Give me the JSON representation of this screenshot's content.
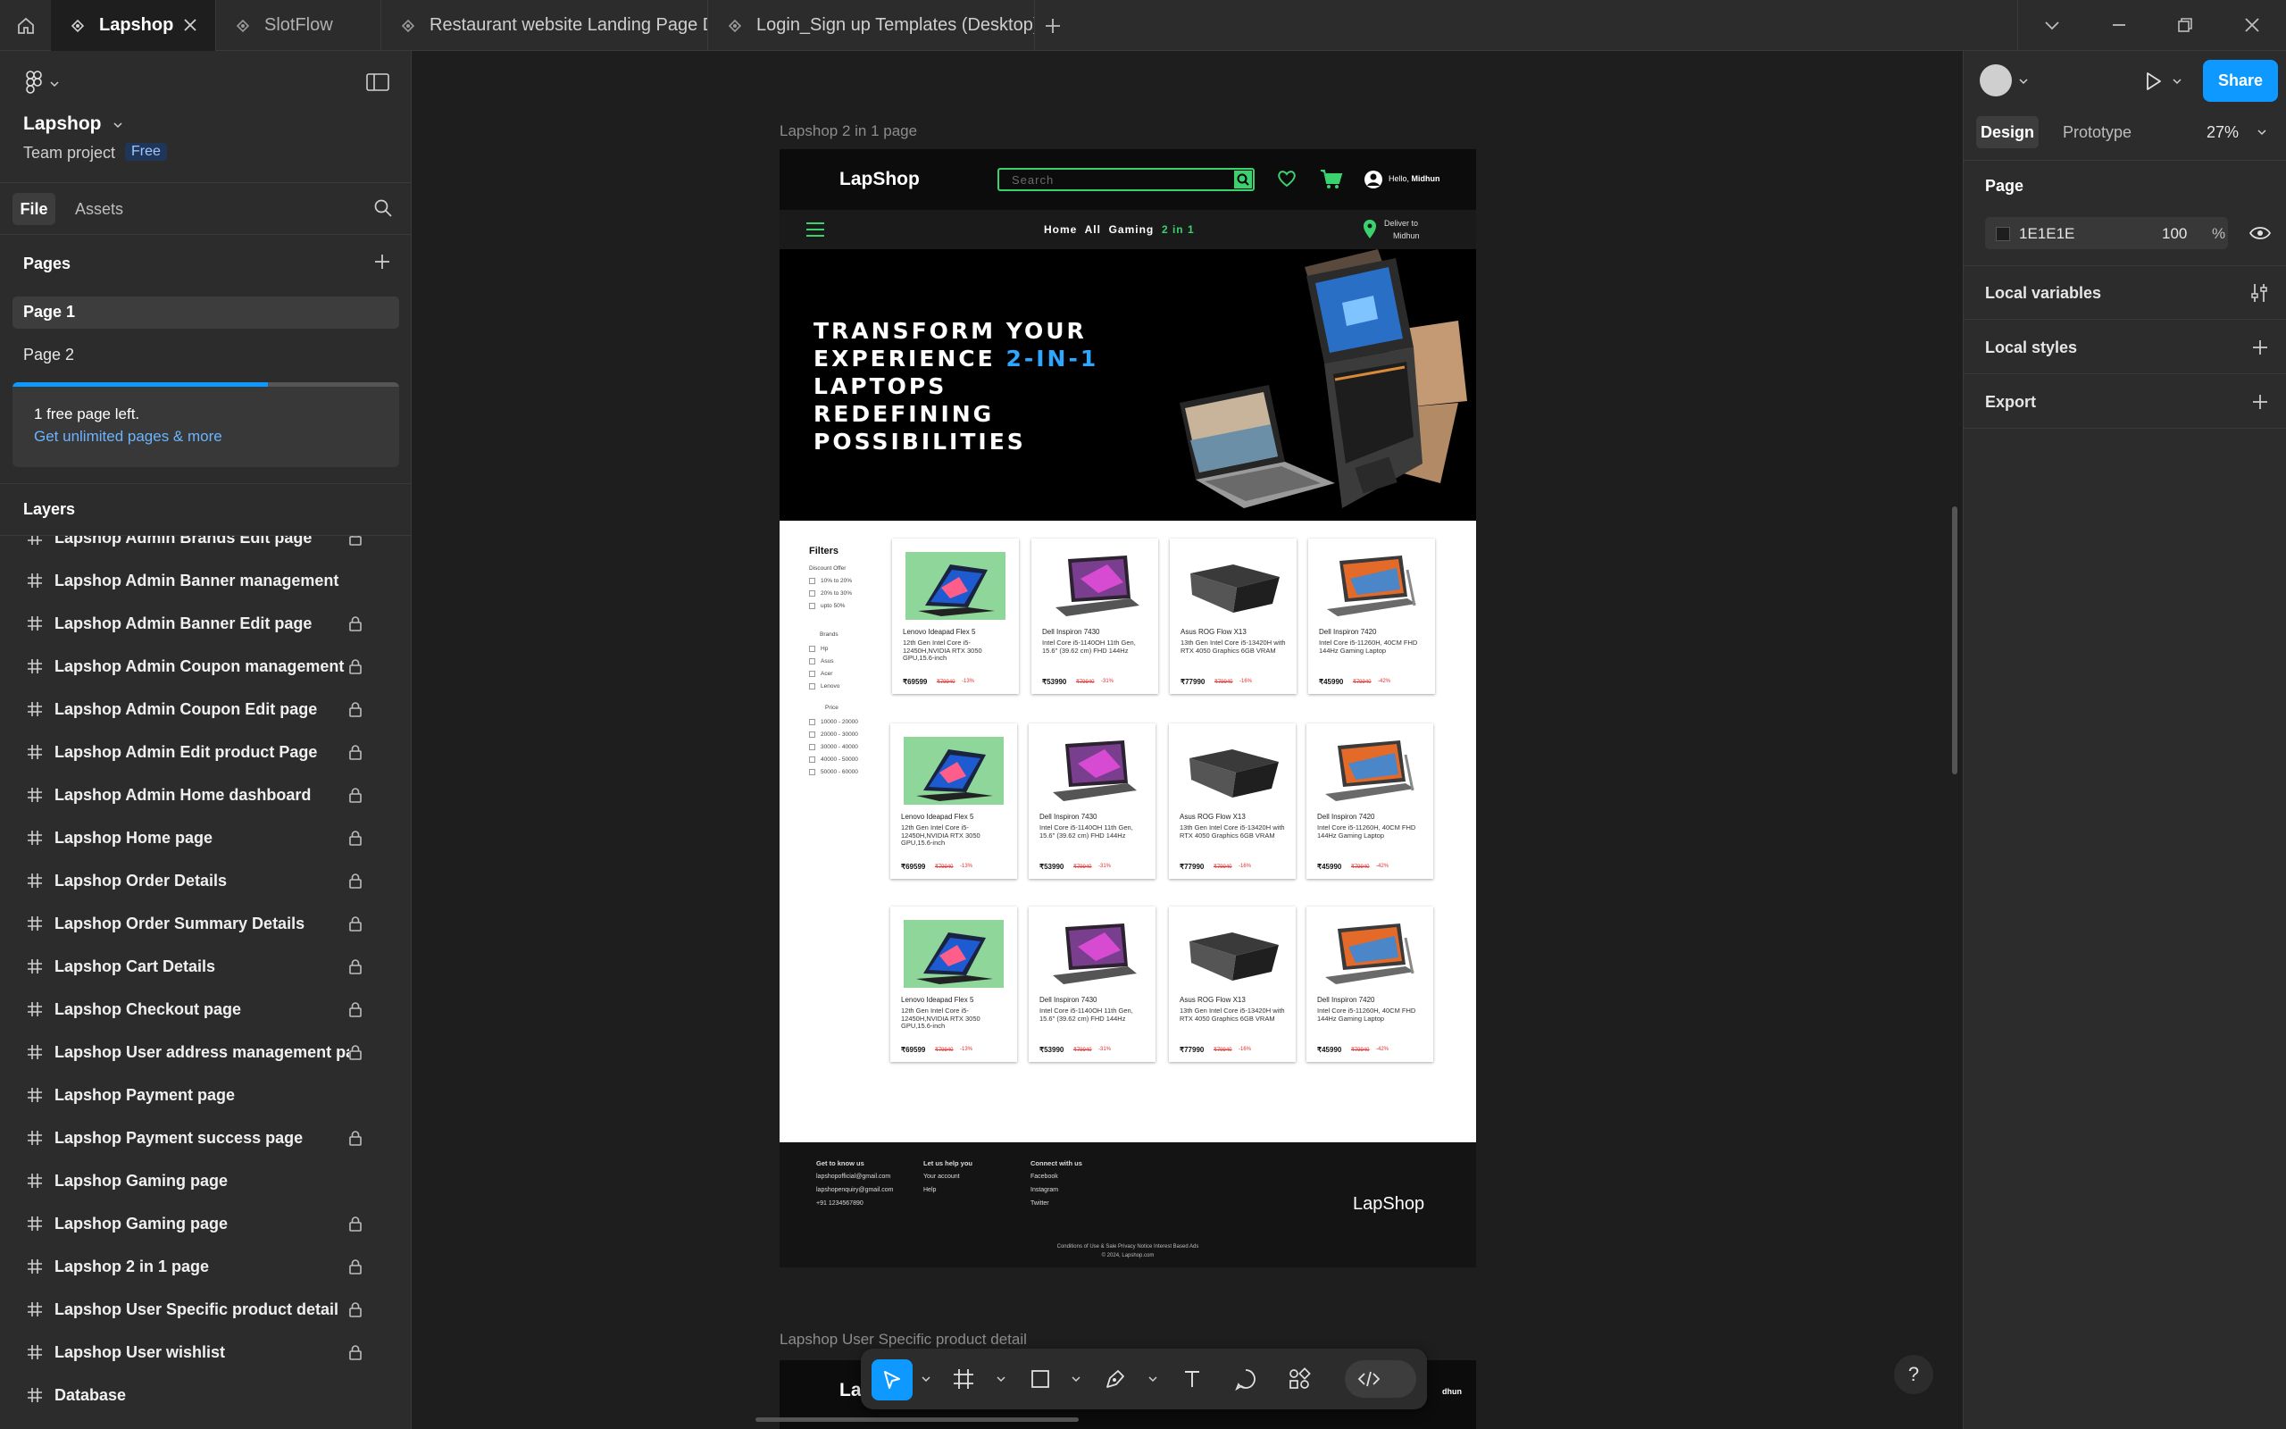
{
  "tabs": [
    {
      "label": "Lapshop",
      "active": true
    },
    {
      "label": "SlotFlow",
      "active": false
    },
    {
      "label": "Restaurant website Landing Page De",
      "active": false
    },
    {
      "label": "Login_Sign up Templates (Desktop) (",
      "active": false
    }
  ],
  "project": {
    "name": "Lapshop",
    "team": "Team project",
    "plan_badge": "Free"
  },
  "panel_tabs": {
    "file": "File",
    "assets": "Assets"
  },
  "pages": {
    "heading": "Pages",
    "items": [
      "Page 1",
      "Page 2"
    ],
    "selected": "Page 1",
    "limit_text": "1 free page left.",
    "upgrade_link": "Get unlimited pages & more",
    "usage_fraction": 0.66
  },
  "layers": {
    "heading": "Layers",
    "items": [
      {
        "name": "Lapshop Admin Brands Edit page",
        "locked": true
      },
      {
        "name": "Lapshop Admin Banner management",
        "locked": false
      },
      {
        "name": "Lapshop Admin Banner Edit page",
        "locked": true
      },
      {
        "name": "Lapshop Admin Coupon management",
        "locked": true
      },
      {
        "name": "Lapshop Admin Coupon Edit page",
        "locked": true
      },
      {
        "name": "Lapshop Admin Edit  product Page",
        "locked": true
      },
      {
        "name": "Lapshop Admin Home dashboard",
        "locked": true
      },
      {
        "name": "Lapshop Home page",
        "locked": true
      },
      {
        "name": "Lapshop Order Details",
        "locked": true
      },
      {
        "name": "Lapshop Order Summary Details",
        "locked": true
      },
      {
        "name": "Lapshop Cart Details",
        "locked": true
      },
      {
        "name": "Lapshop Checkout page",
        "locked": true
      },
      {
        "name": "Lapshop User address management pag",
        "locked": true
      },
      {
        "name": "Lapshop Payment page",
        "locked": false
      },
      {
        "name": "Lapshop Payment success page",
        "locked": true
      },
      {
        "name": "Lapshop Gaming page",
        "locked": false
      },
      {
        "name": "Lapshop Gaming page",
        "locked": true
      },
      {
        "name": "Lapshop 2 in 1 page",
        "locked": true
      },
      {
        "name": "Lapshop User Specific product detail",
        "locked": true
      },
      {
        "name": "Lapshop User wishlist",
        "locked": true
      },
      {
        "name": "Database",
        "locked": false
      }
    ]
  },
  "canvas": {
    "frame_label": "Lapshop 2 in 1 page",
    "frame2_label": "Lapshop User Specific product detail"
  },
  "site": {
    "logo": "LapShop",
    "search_placeholder": "Search",
    "greeting": "Hello,",
    "user": "Midhun",
    "nav": [
      "Home",
      "All",
      "Gaming",
      "2 in 1"
    ],
    "deliver_line1": "Deliver to",
    "deliver_line2": "Midhun",
    "hero_lines": [
      "TRANSFORM YOUR",
      "EXPERIENCE",
      "2-IN-1",
      "LAPTOPS",
      "REDEFINING",
      "POSSIBILITIES"
    ],
    "filters": {
      "title": "Filters",
      "discount_label": "Discount Offer",
      "discounts": [
        "10% to 20%",
        "20% to 30%",
        "upto 50%"
      ],
      "brands_label": "Brands",
      "brands": [
        "Hp",
        "Asus",
        "Acer",
        "Lenovo"
      ],
      "price_label": "Price",
      "prices": [
        "10000 - 20000",
        "20000 - 30000",
        "30000 - 40000",
        "40000 - 50000",
        "50000 - 60000"
      ]
    },
    "products": [
      {
        "name": "Lenovo Ideapad Flex 5",
        "desc": "12th Gen Intel Core i5-12450H,NVIDIA RTX 3050 GPU,15.6-inch",
        "price": "₹69599",
        "old": "₹79940",
        "off": "-13%",
        "img": "lenovo"
      },
      {
        "name": "Dell Inspiron 7430",
        "desc": "Intel Core i5-1140OH 11th Gen, 15.6\" (39.62 cm) FHD 144Hz",
        "price": "₹53990",
        "old": "₹79940",
        "off": "-31%",
        "img": "dell"
      },
      {
        "name": "Asus ROG Flow X13",
        "desc": "13th Gen Intel Core i5-13420H with RTX 4050 Graphics 6GB VRAM",
        "price": "₹77990",
        "old": "₹79940",
        "off": "-16%",
        "img": "asus"
      },
      {
        "name": "Dell Inspiron 7420",
        "desc": "Intel Core i5-11260H, 40CM FHD 144Hz Gaming Laptop",
        "price": "₹45990",
        "old": "₹79940",
        "off": "-42%",
        "img": "dell2"
      }
    ],
    "footer": {
      "col1_title": "Get to know us",
      "col1": [
        "lapshopofficial@gmail.com",
        "lapshopenquiry@gmail.com",
        "+91 1234567890"
      ],
      "col2_title": "Let us help you",
      "col2": [
        "Your account",
        "Help"
      ],
      "col3_title": "Connect with us",
      "col3": [
        "Facebook",
        "Instagram",
        "Twitter"
      ],
      "logo": "LapShop",
      "legal": "Conditions of Use & Sale  Privacy Notice  Interest Based Ads",
      "copyright": "© 2024, Lapshop.com"
    },
    "frame2_peek": {
      "logo_fragment": "La",
      "user_fragment": "dhun"
    }
  },
  "right_panel": {
    "tabs": [
      "Design",
      "Prototype"
    ],
    "active_tab": "Design",
    "zoom": "27%",
    "share": "Share",
    "page_title": "Page",
    "bg_hex": "1E1E1E",
    "bg_opacity": "100",
    "percent": "%",
    "sections": [
      "Local variables",
      "Local styles",
      "Export"
    ]
  },
  "help": "?",
  "colors": {
    "accent": "#0d99ff",
    "site_green": "#3bd16f",
    "hero_blue": "#2ea8ff",
    "discount_red": "#e03030"
  }
}
